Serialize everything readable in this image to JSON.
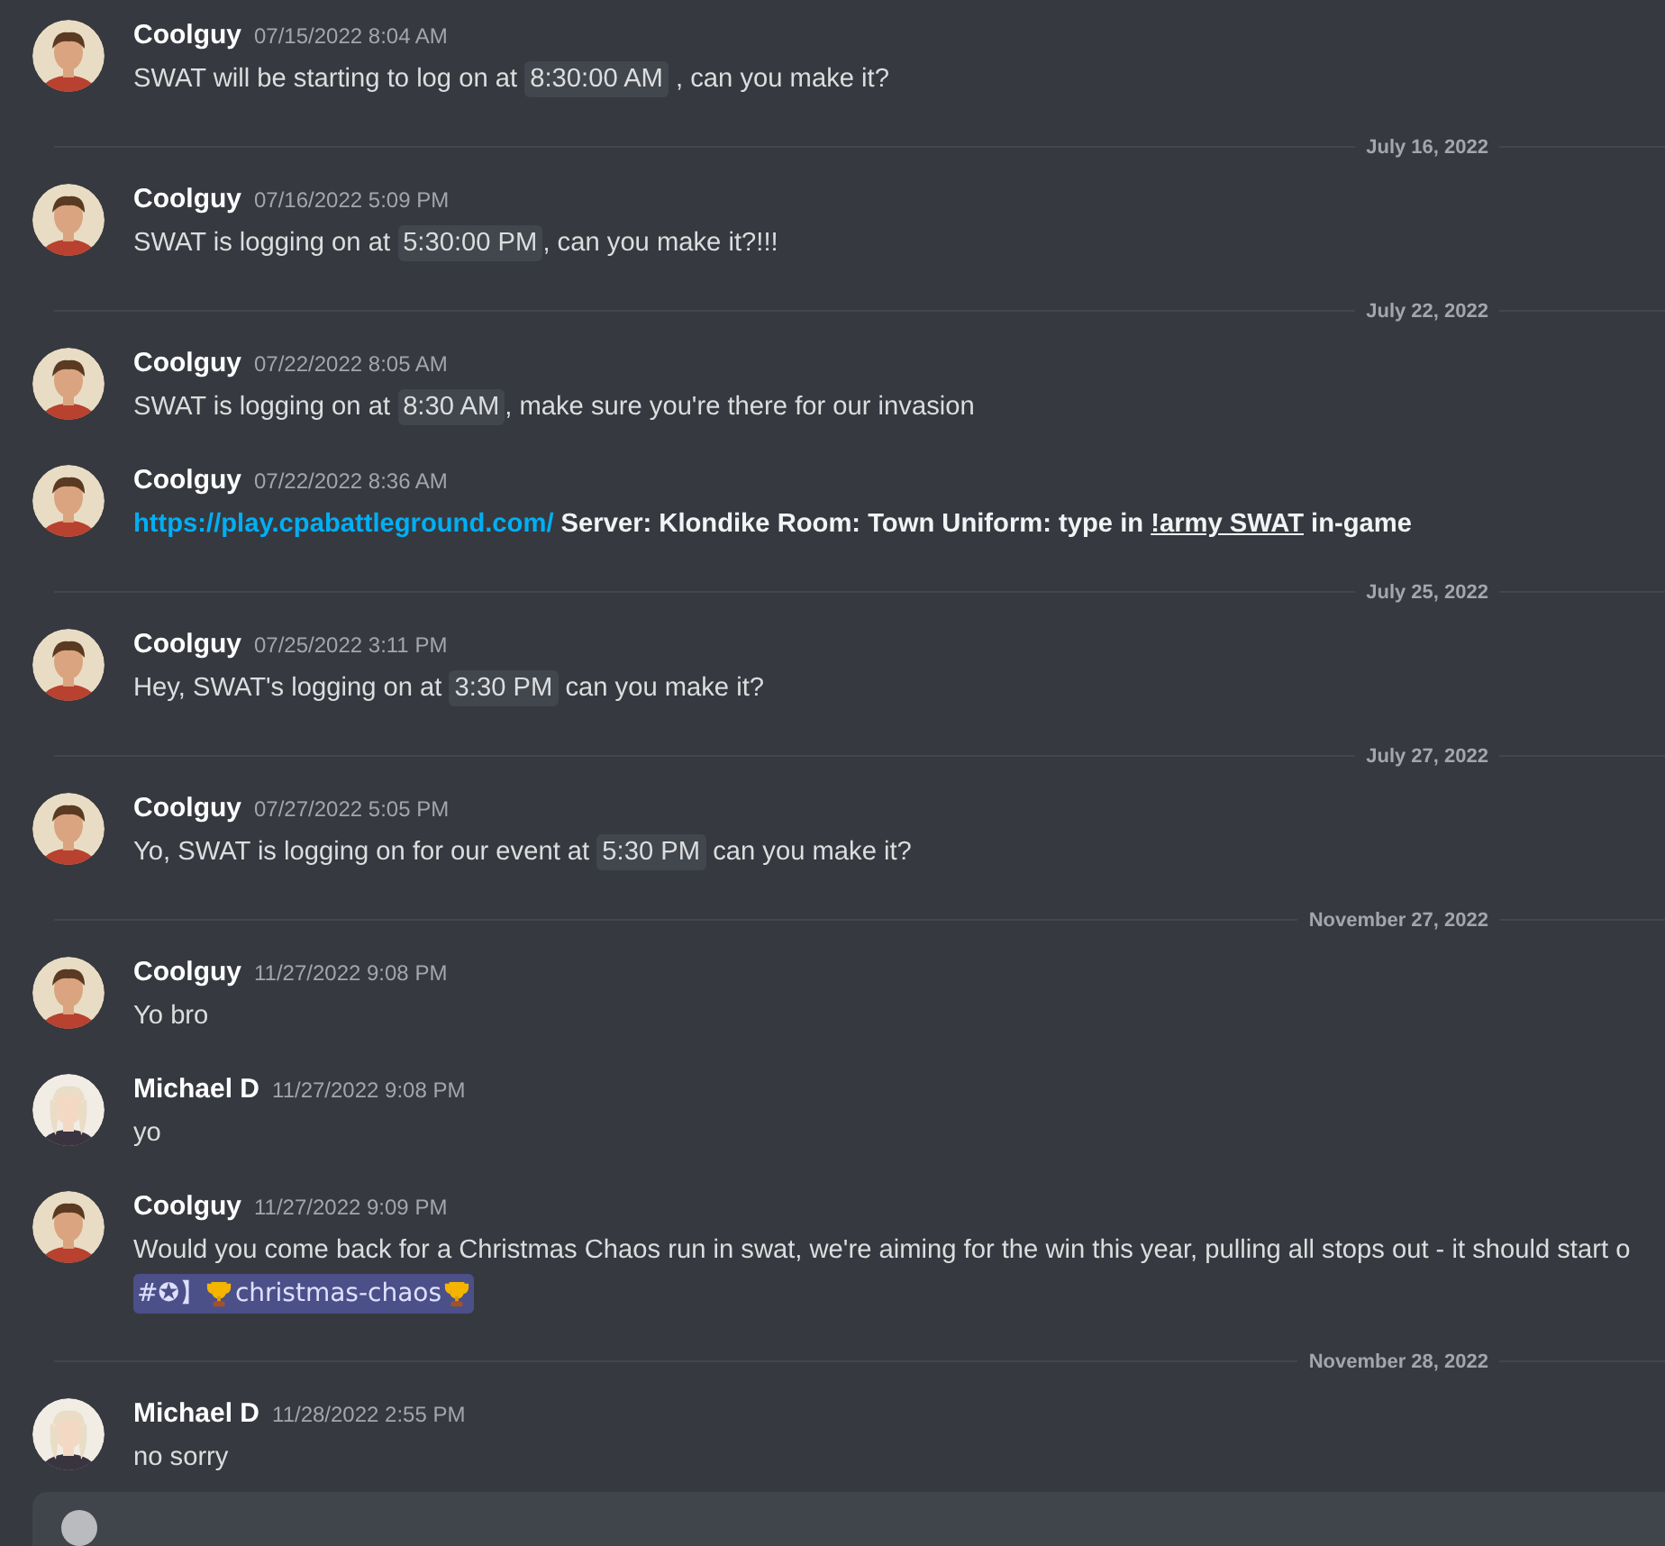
{
  "items": [
    {
      "kind": "message",
      "author": "Coolguy",
      "avatar": {
        "kind": "short_hair"
      },
      "time": "07/15/2022 8:04 AM",
      "lines": [
        [
          {
            "kind": "text",
            "text": "SWAT will be starting to log on at "
          },
          {
            "kind": "timestamp",
            "text": "8:30:00 AM"
          },
          {
            "kind": "text",
            "text": " , can you make it?"
          }
        ]
      ]
    },
    {
      "kind": "divider",
      "label": "July 16, 2022"
    },
    {
      "kind": "message",
      "author": "Coolguy",
      "avatar": {
        "kind": "short_hair"
      },
      "time": "07/16/2022 5:09 PM",
      "lines": [
        [
          {
            "kind": "text",
            "text": "SWAT is logging on at "
          },
          {
            "kind": "timestamp",
            "text": "5:30:00 PM"
          },
          {
            "kind": "text",
            "text": ", can you make it?!!!"
          }
        ]
      ]
    },
    {
      "kind": "divider",
      "label": "July 22, 2022"
    },
    {
      "kind": "message",
      "author": "Coolguy",
      "avatar": {
        "kind": "short_hair"
      },
      "time": "07/22/2022 8:05 AM",
      "lines": [
        [
          {
            "kind": "text",
            "text": "SWAT is logging on at "
          },
          {
            "kind": "timestamp",
            "text": "8:30 AM"
          },
          {
            "kind": "text",
            "text": ", make sure you're there for our invasion"
          }
        ]
      ]
    },
    {
      "kind": "message",
      "author": "Coolguy",
      "avatar": {
        "kind": "short_hair"
      },
      "time": "07/22/2022 8:36 AM",
      "lines": [
        [
          {
            "kind": "link",
            "text": "https://play.cpabattleground.com/"
          },
          {
            "kind": "bold",
            "text": " Server: Klondike Room: Town Uniform: type in "
          },
          {
            "kind": "bold_underline",
            "text": "!army SWAT"
          },
          {
            "kind": "bold",
            "text": " in-game"
          }
        ]
      ]
    },
    {
      "kind": "divider",
      "label": "July 25, 2022"
    },
    {
      "kind": "message",
      "author": "Coolguy",
      "avatar": {
        "kind": "short_hair"
      },
      "time": "07/25/2022 3:11 PM",
      "lines": [
        [
          {
            "kind": "text",
            "text": "Hey, SWAT's logging on at "
          },
          {
            "kind": "timestamp",
            "text": "3:30 PM"
          },
          {
            "kind": "text",
            "text": " can you make it?"
          }
        ]
      ]
    },
    {
      "kind": "divider",
      "label": "July 27, 2022"
    },
    {
      "kind": "message",
      "author": "Coolguy",
      "avatar": {
        "kind": "short_hair"
      },
      "time": "07/27/2022 5:05 PM",
      "lines": [
        [
          {
            "kind": "text",
            "text": "Yo, SWAT is logging on for our event at "
          },
          {
            "kind": "timestamp",
            "text": "5:30 PM"
          },
          {
            "kind": "text",
            "text": " can you make it?"
          }
        ]
      ]
    },
    {
      "kind": "divider",
      "label": "November 27, 2022"
    },
    {
      "kind": "message",
      "author": "Coolguy",
      "avatar": {
        "kind": "short_hair"
      },
      "time": "11/27/2022 9:08 PM",
      "lines": [
        [
          {
            "kind": "text",
            "text": "Yo bro"
          }
        ]
      ]
    },
    {
      "kind": "message",
      "author": "Michael D",
      "avatar": {
        "kind": "long_hair"
      },
      "time": "11/27/2022 9:08 PM",
      "lines": [
        [
          {
            "kind": "text",
            "text": "yo"
          }
        ]
      ]
    },
    {
      "kind": "message",
      "author": "Coolguy",
      "avatar": {
        "kind": "short_hair"
      },
      "time": "11/27/2022 9:09 PM",
      "lines": [
        [
          {
            "kind": "text",
            "text": "Would you come back for a Christmas Chaos run in swat, we're aiming for the win this year, pulling all stops out - it should start o"
          }
        ],
        [
          {
            "kind": "mention",
            "prefix": "#✪】",
            "text": "christmas-chaos"
          }
        ]
      ]
    },
    {
      "kind": "divider",
      "label": "November 28, 2022"
    },
    {
      "kind": "message",
      "author": "Michael D",
      "avatar": {
        "kind": "long_hair"
      },
      "time": "11/28/2022 2:55 PM",
      "lines": [
        [
          {
            "kind": "text",
            "text": "no sorry"
          }
        ]
      ]
    }
  ],
  "composer": {
    "kind": "field"
  }
}
